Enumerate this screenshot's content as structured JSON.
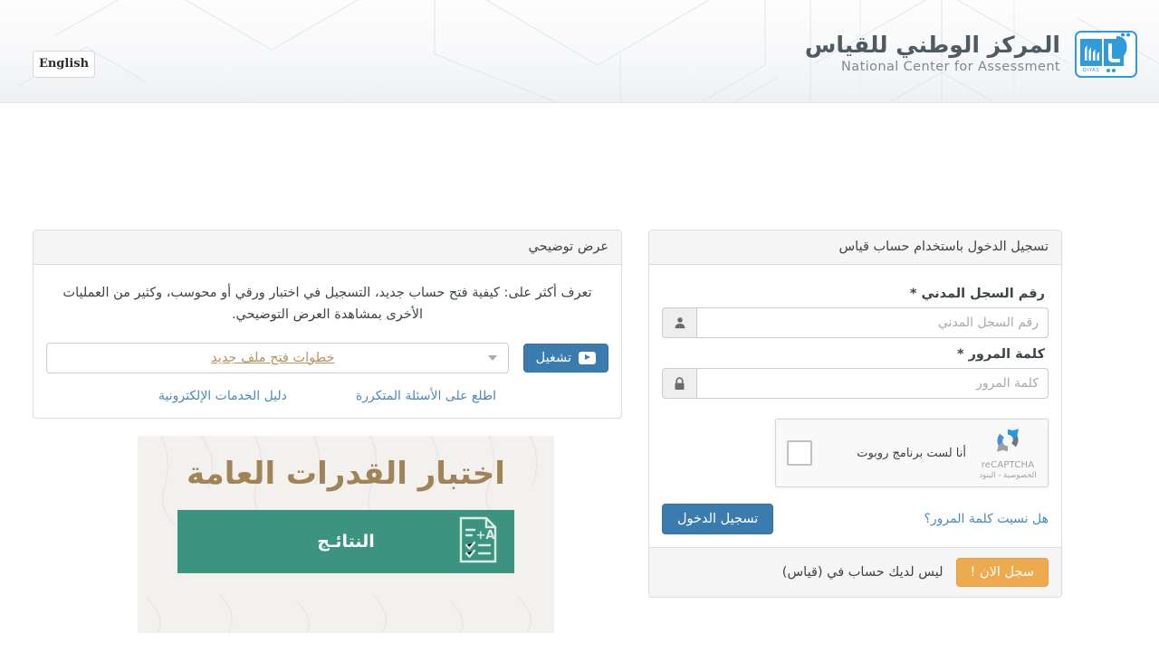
{
  "header": {
    "lang_button": "English",
    "brand_ar": "المركز الوطني للقياس",
    "brand_en": "National Center for Assessment",
    "logo_caption": "QIYAS"
  },
  "login": {
    "panel_title": "تسجيل الدخول باستخدام حساب قياس",
    "national_id": {
      "label": "رقم السجل المدني *",
      "placeholder": "رقم السجل المدني",
      "value": "",
      "icon": "user-icon"
    },
    "password": {
      "label": "كلمة المرور *",
      "placeholder": "كلمة المرور",
      "value": "",
      "icon": "lock-icon"
    },
    "recaptcha": {
      "checkbox_label": "أنا لست برنامج روبوت",
      "brand": "reCAPTCHA",
      "legal": "الخصوصية - البنود",
      "checked": false
    },
    "forgot_password_link": "هل نسيت كلمة المرور؟",
    "submit_button": "تسجيل الدخول",
    "footer_text": "ليس لديك حساب في (قياس)",
    "register_button": "سجل الان !"
  },
  "demo": {
    "panel_title": "عرض توضيحي",
    "description": "تعرف أكثر على: كيفية فتح حساب جديد، التسجيل في اختبار ورقي أو محوسب، وكثير من العمليات الأخرى بمشاهدة العرض التوضيحي.",
    "select_value": "خطوات فتح ملف جديد",
    "play_button": "تشغيل",
    "faq_link": "اطلع على الأسئلة المتكررة",
    "eservices_link": "دليل الخدمات الإلكترونية"
  },
  "banner": {
    "title": "اختبار القدرات العامة",
    "box_label": "النتائـج",
    "icon_grade": "A+"
  },
  "colors": {
    "primary_blue": "#3a7cad",
    "warning_orange": "#edaa4f",
    "link_blue": "#4a89b8",
    "banner_gold": "#a08457",
    "banner_green": "#3c9480",
    "logo_blue": "#2f9bdb"
  }
}
